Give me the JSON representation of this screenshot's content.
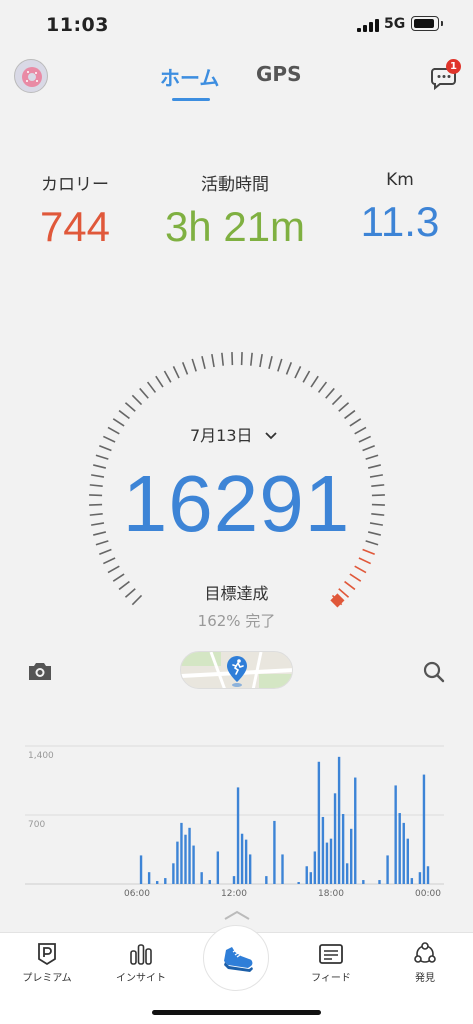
{
  "status": {
    "time": "11:03",
    "network": "5G"
  },
  "header": {
    "tabs": [
      "ホーム",
      "GPS"
    ],
    "badge": "1"
  },
  "stats": [
    {
      "label": "カロリー",
      "value": "744",
      "color": "#e0583a"
    },
    {
      "label": "活動時間",
      "value": "3h 21m",
      "color": "#7fb041"
    },
    {
      "label": "Km",
      "value": "11.3",
      "color": "#3d84d6"
    }
  ],
  "gauge": {
    "date": "7月13日",
    "steps": "16291",
    "goal_label": "目標達成",
    "goal_pct": "162% 完了",
    "progress": 1.62
  },
  "icons": {
    "camera": "camera-icon",
    "search": "search-icon",
    "map": "map-runner-icon"
  },
  "chart_data": {
    "type": "bar",
    "x_tick_labels": [
      "06:00",
      "12:00",
      "18:00",
      "00:00"
    ],
    "y_tick_labels": [
      "1,400",
      "700"
    ],
    "ylim": [
      0,
      1400
    ],
    "x_range_hours": [
      0,
      24
    ],
    "color": "#3d84d6",
    "bars": [
      {
        "h": 6.25,
        "v": 290
      },
      {
        "h": 6.75,
        "v": 120
      },
      {
        "h": 7.25,
        "v": 30
      },
      {
        "h": 7.75,
        "v": 60
      },
      {
        "h": 8.25,
        "v": 210
      },
      {
        "h": 8.5,
        "v": 430
      },
      {
        "h": 8.75,
        "v": 620
      },
      {
        "h": 9.0,
        "v": 500
      },
      {
        "h": 9.25,
        "v": 570
      },
      {
        "h": 9.5,
        "v": 390
      },
      {
        "h": 10.0,
        "v": 120
      },
      {
        "h": 10.5,
        "v": 40
      },
      {
        "h": 11.0,
        "v": 330
      },
      {
        "h": 12.0,
        "v": 80
      },
      {
        "h": 12.25,
        "v": 980
      },
      {
        "h": 12.5,
        "v": 510
      },
      {
        "h": 12.75,
        "v": 450
      },
      {
        "h": 13.0,
        "v": 300
      },
      {
        "h": 14.0,
        "v": 80
      },
      {
        "h": 14.5,
        "v": 640
      },
      {
        "h": 15.0,
        "v": 300
      },
      {
        "h": 16.0,
        "v": 20
      },
      {
        "h": 16.5,
        "v": 180
      },
      {
        "h": 16.75,
        "v": 120
      },
      {
        "h": 17.0,
        "v": 330
      },
      {
        "h": 17.25,
        "v": 1240
      },
      {
        "h": 17.5,
        "v": 680
      },
      {
        "h": 17.75,
        "v": 420
      },
      {
        "h": 18.0,
        "v": 460
      },
      {
        "h": 18.25,
        "v": 920
      },
      {
        "h": 18.5,
        "v": 1290
      },
      {
        "h": 18.75,
        "v": 710
      },
      {
        "h": 19.0,
        "v": 210
      },
      {
        "h": 19.25,
        "v": 560
      },
      {
        "h": 19.5,
        "v": 1080
      },
      {
        "h": 20.0,
        "v": 40
      },
      {
        "h": 21.0,
        "v": 40
      },
      {
        "h": 21.5,
        "v": 290
      },
      {
        "h": 22.0,
        "v": 1000
      },
      {
        "h": 22.25,
        "v": 720
      },
      {
        "h": 22.5,
        "v": 620
      },
      {
        "h": 22.75,
        "v": 460
      },
      {
        "h": 23.0,
        "v": 60
      },
      {
        "h": 23.5,
        "v": 120
      },
      {
        "h": 23.75,
        "v": 1110
      },
      {
        "h": 24.0,
        "v": 180
      }
    ]
  },
  "nav": [
    {
      "label": "プレミアム",
      "icon": "premium-icon"
    },
    {
      "label": "インサイト",
      "icon": "insight-icon"
    },
    {
      "label": "",
      "icon": "shoe-icon"
    },
    {
      "label": "フィード",
      "icon": "feed-icon"
    },
    {
      "label": "発見",
      "icon": "discover-icon"
    }
  ]
}
